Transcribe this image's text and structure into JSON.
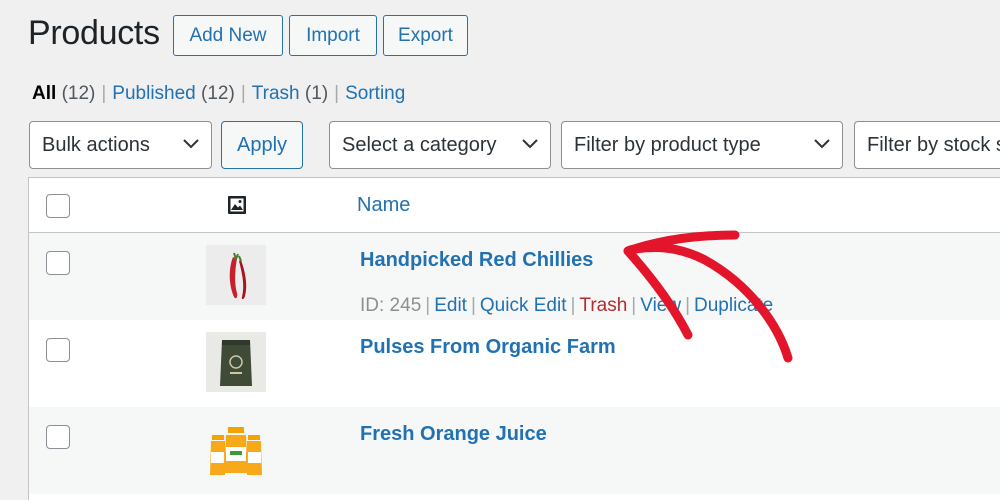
{
  "page_title": "Products",
  "header_buttons": {
    "add_new": "Add New",
    "import": "Import",
    "export": "Export"
  },
  "filters": {
    "all_label": "All",
    "all_count": "(12)",
    "published_label": "Published",
    "published_count": "(12)",
    "trash_label": "Trash",
    "trash_count": "(1)",
    "sorting_label": "Sorting"
  },
  "toolbar": {
    "bulk_actions": "Bulk actions",
    "apply": "Apply",
    "category": "Select a category",
    "product_type": "Filter by product type",
    "stock": "Filter by stock status"
  },
  "table": {
    "name_header": "Name",
    "rows": [
      {
        "name": "Handpicked Red Chillies",
        "actions": {
          "id": "ID: 245",
          "edit": "Edit",
          "quick_edit": "Quick Edit",
          "trash": "Trash",
          "view": "View",
          "duplicate": "Duplicate"
        }
      },
      {
        "name": "Pulses From Organic Farm"
      },
      {
        "name": "Fresh Orange Juice"
      }
    ]
  },
  "colors": {
    "link": "#2271b1",
    "trash": "#b32d2e",
    "annotation": "#e3152a"
  }
}
